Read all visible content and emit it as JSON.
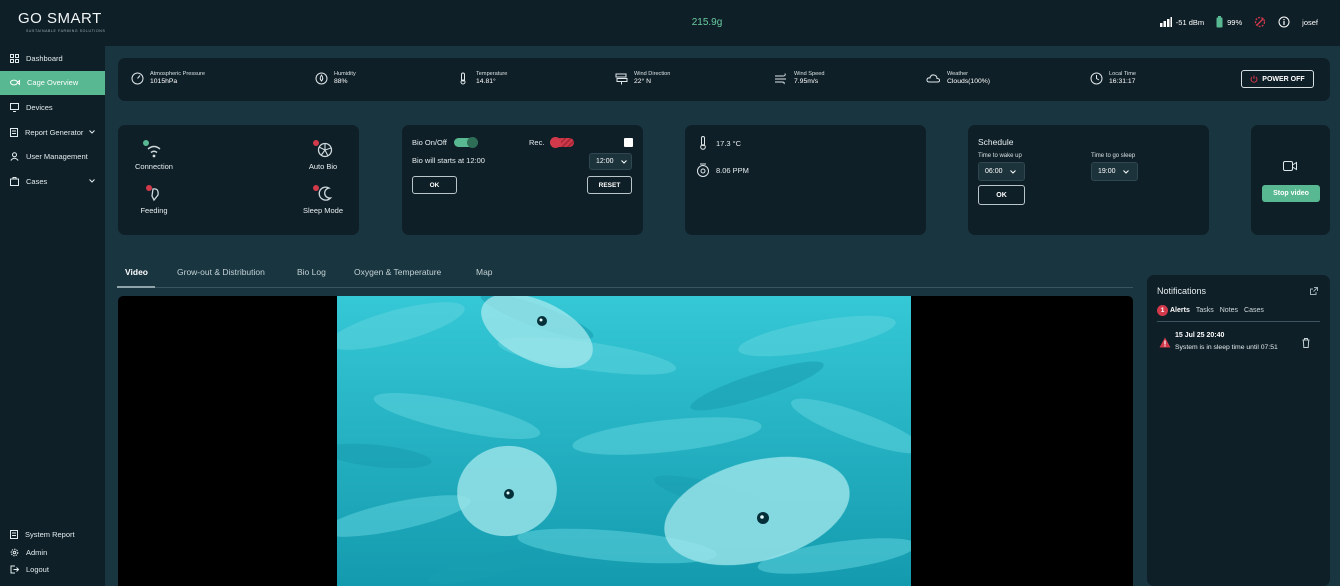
{
  "app": {
    "logo": "GO SMART",
    "logo_tagline": "SUSTAINABLE FARMING SOLUTIONS"
  },
  "header": {
    "weight": "215.9g",
    "signal": "-51 dBm",
    "battery": "99%",
    "user": "josef"
  },
  "sidebar": {
    "items": [
      {
        "label": "Dashboard",
        "icon": "grid-icon"
      },
      {
        "label": "Cage Overview",
        "icon": "fish-icon",
        "active": true
      },
      {
        "label": "Devices",
        "icon": "device-icon"
      },
      {
        "label": "Report Generator",
        "icon": "report-icon",
        "has_submenu": true
      },
      {
        "label": "User Management",
        "icon": "user-icon"
      },
      {
        "label": "Cases",
        "icon": "cases-icon",
        "has_submenu": true
      }
    ],
    "bottom_items": [
      {
        "label": "System Report",
        "icon": "report-icon"
      },
      {
        "label": "Admin",
        "icon": "gear-icon"
      },
      {
        "label": "Logout",
        "icon": "logout-icon"
      }
    ]
  },
  "stats": {
    "pressure": {
      "label": "Atmospheric Pressure",
      "value": "1015hPa"
    },
    "humidity": {
      "label": "Humidity",
      "value": "88%"
    },
    "temperature": {
      "label": "Temperature",
      "value": "14.81°"
    },
    "wind_direction": {
      "label": "Wind Direction",
      "value": "22° N"
    },
    "wind_speed": {
      "label": "Wind Speed",
      "value": "7.95m/s"
    },
    "weather": {
      "label": "Weather",
      "value": "Clouds(100%)"
    },
    "local_time": {
      "label": "Local Time",
      "value": "16:31:17"
    },
    "power_off": "POWER OFF"
  },
  "status": {
    "connection": "Connection",
    "auto_bio": "Auto Bio",
    "feeding": "Feeding",
    "sleep_mode": "Sleep Mode",
    "colors": {
      "ok": "#57b892",
      "alert": "#d23a4b"
    }
  },
  "bio": {
    "toggle_label": "Bio On/Off",
    "bio_on": true,
    "rec_label": "Rec.",
    "rec_on": false,
    "message": "Bio will starts at 12:00",
    "time_value": "12:00",
    "ok_label": "OK",
    "reset_label": "RESET"
  },
  "sensors": {
    "temperature": "17.3 °C",
    "oxygen": "8.06 PPM"
  },
  "schedule": {
    "title": "Schedule",
    "wake_label": "Time to wake up",
    "wake_value": "06:00",
    "sleep_label": "Time to go sleep",
    "sleep_value": "19:00",
    "ok_label": "OK"
  },
  "video_card": {
    "stop_label": "Stop video"
  },
  "tabs": [
    {
      "label": "Video",
      "active": true
    },
    {
      "label": "Grow-out & Distribution"
    },
    {
      "label": "Bio Log"
    },
    {
      "label": "Oxygen & Temperature"
    },
    {
      "label": "Map"
    }
  ],
  "notifications": {
    "title": "Notifications",
    "tabs": [
      "Alerts",
      "Tasks",
      "Notes",
      "Cases"
    ],
    "alert_count": "1",
    "items": [
      {
        "time": "15 Jul 25 20:40",
        "text": "System is in sleep time until 07:51"
      }
    ]
  },
  "theme": {
    "accent": "#57b892",
    "panel": "#0f1f27",
    "background": "#183540",
    "danger": "#d23a4b"
  }
}
